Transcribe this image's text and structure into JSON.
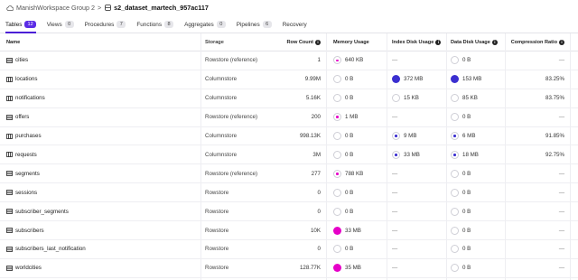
{
  "breadcrumb": {
    "workspace": "ManishWorkspace Group 2",
    "separator": ">",
    "database": "s2_dataset_martech_957ac117"
  },
  "tabs": [
    {
      "label": "Tables",
      "count": "12",
      "active": true
    },
    {
      "label": "Views",
      "count": "0"
    },
    {
      "label": "Procedures",
      "count": "7"
    },
    {
      "label": "Functions",
      "count": "8"
    },
    {
      "label": "Aggregates",
      "count": "0"
    },
    {
      "label": "Pipelines",
      "count": "6"
    },
    {
      "label": "Recovery",
      "count": ""
    }
  ],
  "columns": {
    "name": "Name",
    "storage": "Storage",
    "row_count": "Row Count",
    "memory": "Memory Usage",
    "index_disk": "Index Disk Usage",
    "data_disk": "Data Disk Usage",
    "compression": "Compression Ratio"
  },
  "colors": {
    "accent": "#5b2ce6",
    "memory": "#e600c8",
    "disk": "#3b2fd0"
  },
  "rows": [
    {
      "name": "cities",
      "icon": "rowstore-table-icon",
      "storage": "Rowstore (reference)",
      "rows": "1",
      "memory": "640 KB",
      "memory_level": 0.1,
      "index": "—",
      "index_level": null,
      "data": "0 B",
      "data_level": 0,
      "compression": "—"
    },
    {
      "name": "locations",
      "icon": "columnstore-table-icon",
      "storage": "Columnstore",
      "rows": "9.99M",
      "memory": "0 B",
      "memory_level": 0,
      "index": "372 MB",
      "index_level": 1,
      "data": "153 MB",
      "data_level": 1,
      "compression": "83.25%"
    },
    {
      "name": "notifications",
      "icon": "columnstore-table-icon",
      "storage": "Columnstore",
      "rows": "5.16K",
      "memory": "0 B",
      "memory_level": 0,
      "index": "15 KB",
      "index_level": 0,
      "data": "85 KB",
      "data_level": 0,
      "compression": "83.75%"
    },
    {
      "name": "offers",
      "icon": "rowstore-table-icon",
      "storage": "Rowstore (reference)",
      "rows": "200",
      "memory": "1 MB",
      "memory_level": 0.1,
      "index": "—",
      "index_level": null,
      "data": "0 B",
      "data_level": 0,
      "compression": "—"
    },
    {
      "name": "purchases",
      "icon": "columnstore-table-icon",
      "storage": "Columnstore",
      "rows": "998.13K",
      "memory": "0 B",
      "memory_level": 0,
      "index": "9 MB",
      "index_level": 0.1,
      "data": "6 MB",
      "data_level": 0.1,
      "compression": "91.85%"
    },
    {
      "name": "requests",
      "icon": "columnstore-table-icon",
      "storage": "Columnstore",
      "rows": "3M",
      "memory": "0 B",
      "memory_level": 0,
      "index": "33 MB",
      "index_level": 0.1,
      "data": "18 MB",
      "data_level": 0.1,
      "compression": "92.75%"
    },
    {
      "name": "segments",
      "icon": "rowstore-table-icon",
      "storage": "Rowstore (reference)",
      "rows": "277",
      "memory": "788 KB",
      "memory_level": 0.1,
      "index": "—",
      "index_level": null,
      "data": "0 B",
      "data_level": 0,
      "compression": "—"
    },
    {
      "name": "sessions",
      "icon": "rowstore-table-icon",
      "storage": "Rowstore",
      "rows": "0",
      "memory": "0 B",
      "memory_level": 0,
      "index": "—",
      "index_level": null,
      "data": "0 B",
      "data_level": 0,
      "compression": "—"
    },
    {
      "name": "subscriber_segments",
      "icon": "rowstore-table-icon",
      "storage": "Rowstore",
      "rows": "0",
      "memory": "0 B",
      "memory_level": 0,
      "index": "—",
      "index_level": null,
      "data": "0 B",
      "data_level": 0,
      "compression": "—"
    },
    {
      "name": "subscribers",
      "icon": "rowstore-table-icon",
      "storage": "Rowstore",
      "rows": "10K",
      "memory": "33 MB",
      "memory_level": 1,
      "index": "—",
      "index_level": null,
      "data": "0 B",
      "data_level": 0,
      "compression": "—"
    },
    {
      "name": "subscribers_last_notification",
      "icon": "rowstore-table-icon",
      "storage": "Rowstore",
      "rows": "0",
      "memory": "0 B",
      "memory_level": 0,
      "index": "—",
      "index_level": null,
      "data": "0 B",
      "data_level": 0,
      "compression": "—"
    },
    {
      "name": "worldcities",
      "icon": "rowstore-table-icon",
      "storage": "Rowstore",
      "rows": "128.77K",
      "memory": "35 MB",
      "memory_level": 1,
      "index": "—",
      "index_level": null,
      "data": "0 B",
      "data_level": 0,
      "compression": "—"
    }
  ]
}
